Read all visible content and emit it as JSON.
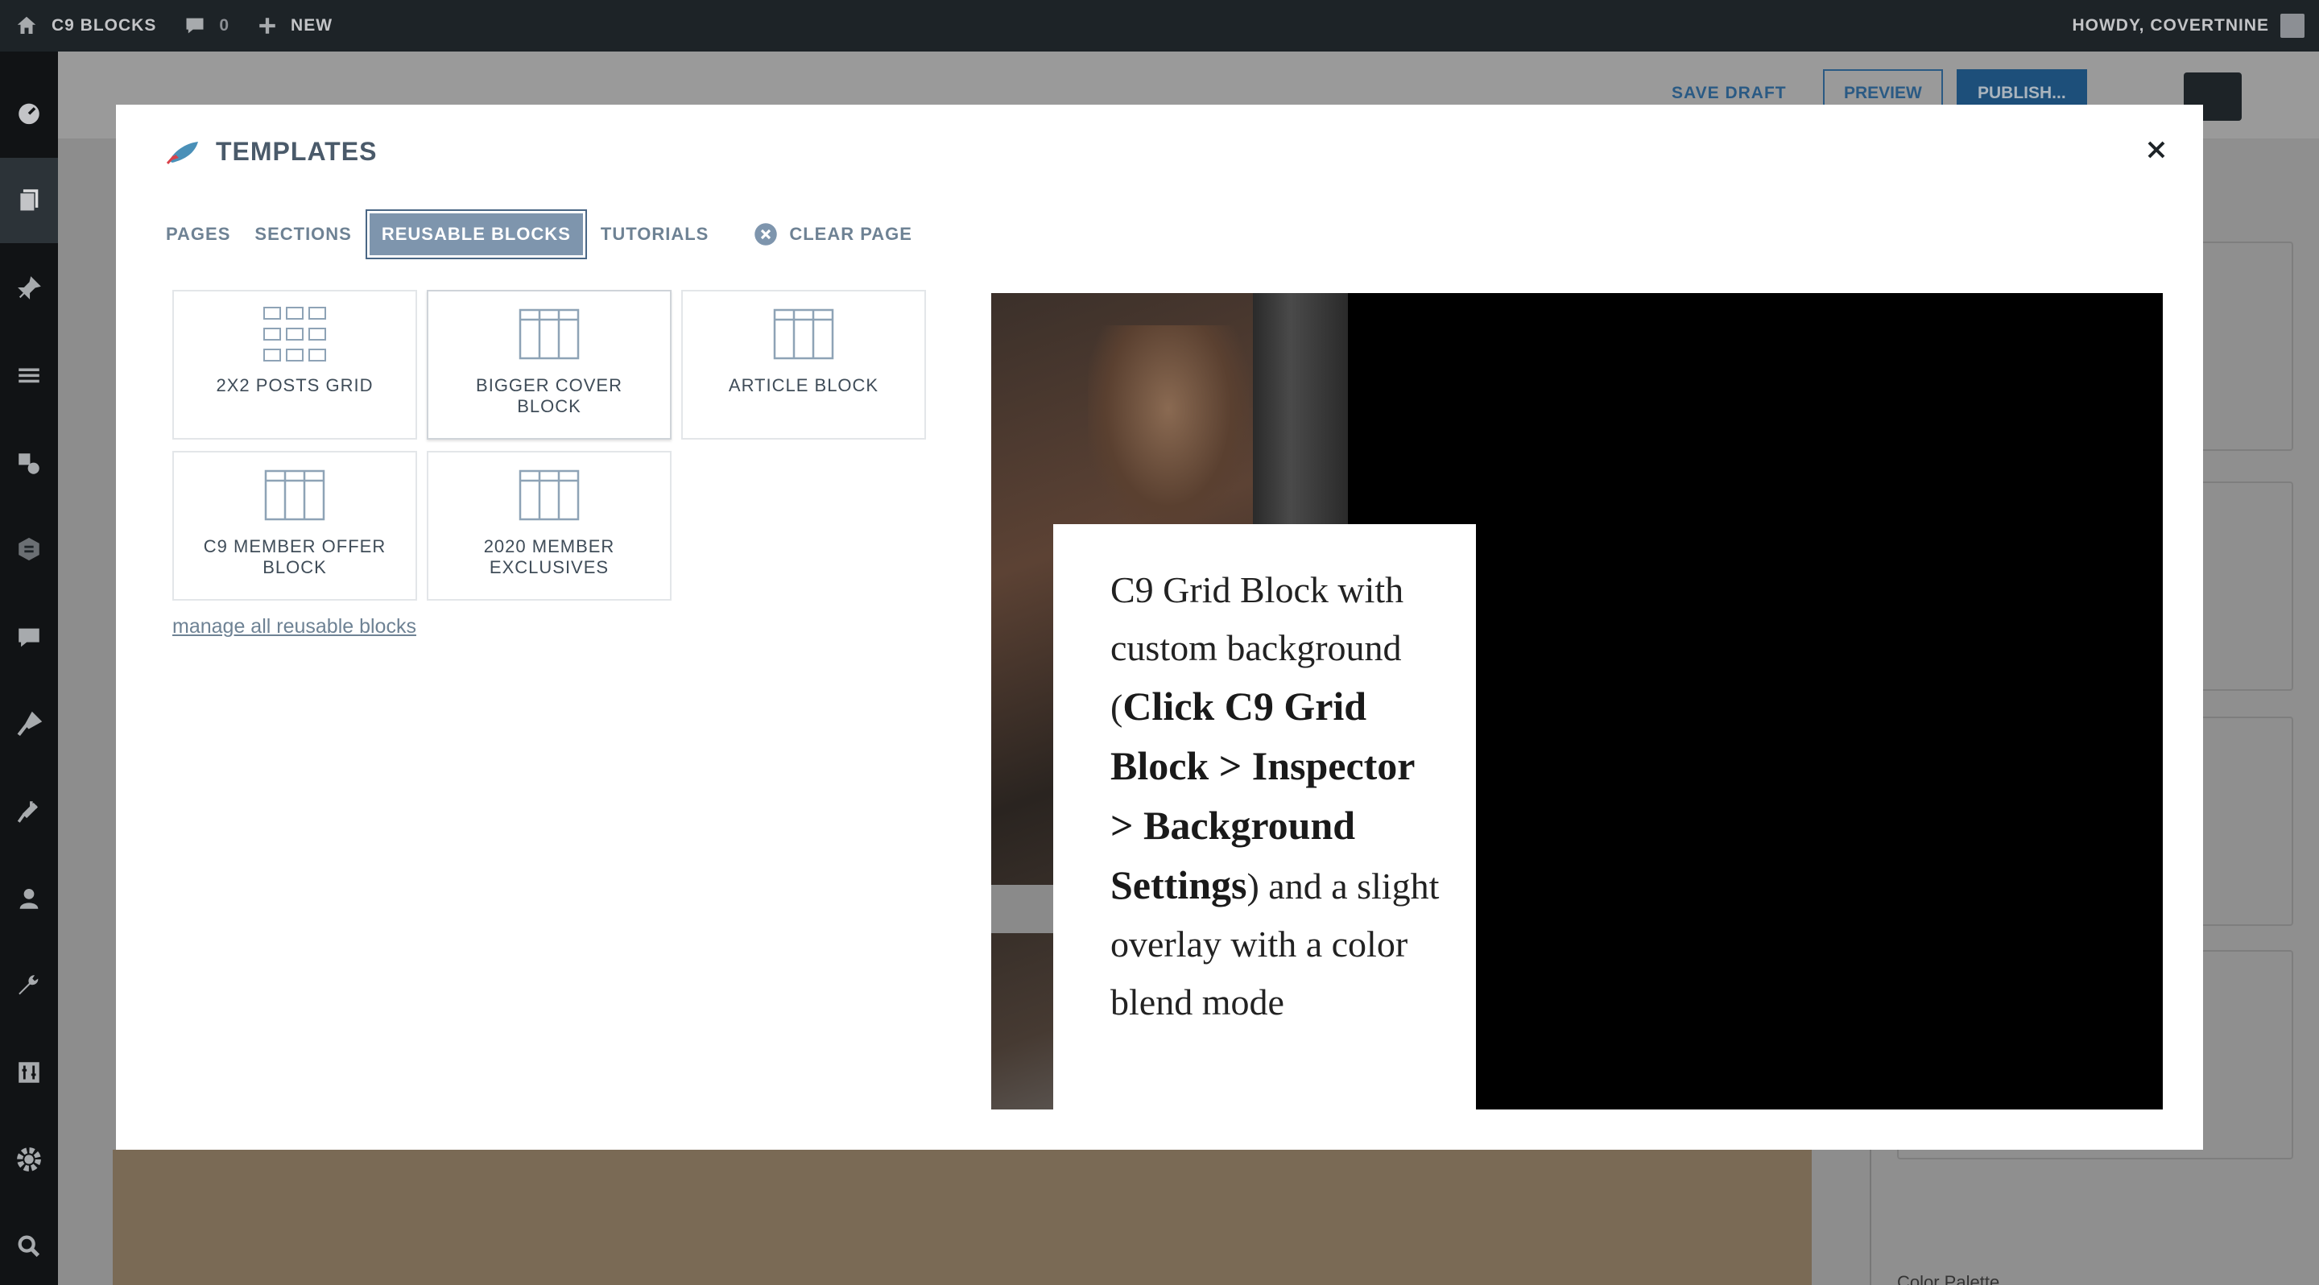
{
  "adminbar": {
    "site_name": "C9 BLOCKS",
    "comments_count": "0",
    "new_label": "NEW",
    "greeting": "HOWDY, COVERTNINE"
  },
  "editor": {
    "save_draft": "SAVE DRAFT",
    "preview": "PREVIEW",
    "publish": "PUBLISH...",
    "inspector_label": "Color Palette"
  },
  "modal": {
    "title": "TEMPLATES",
    "tabs": [
      {
        "label": "PAGES"
      },
      {
        "label": "SECTIONS"
      },
      {
        "label": "REUSABLE BLOCKS"
      },
      {
        "label": "TUTORIALS"
      }
    ],
    "clear_page": "CLEAR PAGE",
    "blocks": [
      {
        "label": "2X2 POSTS GRID",
        "icon": "grid-icon"
      },
      {
        "label": "BIGGER COVER BLOCK",
        "icon": "columns-icon"
      },
      {
        "label": "ARTICLE BLOCK",
        "icon": "columns-icon"
      },
      {
        "label": "C9 MEMBER OFFER BLOCK",
        "icon": "columns-icon"
      },
      {
        "label": "2020 MEMBER EXCLUSIVES",
        "icon": "columns-icon"
      }
    ],
    "manage_link": "manage all reusable blocks",
    "preview_text": {
      "intro": "C9 Grid Block with custom background (",
      "bold": "Click C9 Grid Block > Inspector > Background Settings",
      "outro": ") and a slight overlay with a color blend mode"
    }
  }
}
